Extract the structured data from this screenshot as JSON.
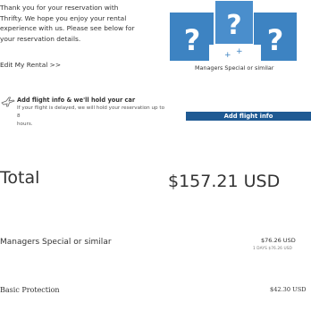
{
  "intro": {
    "line1": "Thank you for your reservation with",
    "line2": "Thrifty. We hope you enjoy your rental",
    "line3": "experience with us. Please see below for",
    "line4": "your reservation details."
  },
  "edit_link": "Edit My Rental >>",
  "car": {
    "caption": "Managers Special or similar",
    "image_icon": "question-mark-placeholder",
    "tile_color": "#3d83c2"
  },
  "flight": {
    "icon": "plane-icon",
    "title": "Add flight info & we'll hold your car",
    "line1": "If your flight is delayed, we will hold your reservation up to 8",
    "line2": "hours.",
    "button_label": "Add flight info",
    "button_color": "#1f5a93"
  },
  "total": {
    "label": "Total",
    "value": "$157.21 USD"
  },
  "line_items": [
    {
      "label": "Managers Special or similar",
      "price": "$76.26 USD",
      "sub": "1 DAYS $76.26 USD"
    },
    {
      "label": "Basic Protection",
      "price": "$42.30 USD"
    }
  ]
}
